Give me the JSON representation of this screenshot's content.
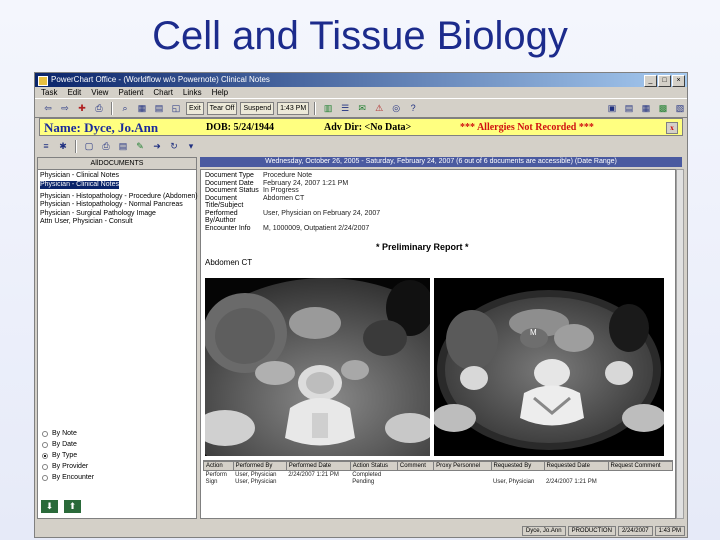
{
  "slide": {
    "title": "Cell and Tissue Biology"
  },
  "window": {
    "title": "PowerChart Office - (Worldflow w/o Powernote) Clinical Notes"
  },
  "menu": [
    "Task",
    "Edit",
    "View",
    "Patient",
    "Chart",
    "Links",
    "Help"
  ],
  "toolbar": {
    "exit_label": "Exit",
    "tearoff_label": "Tear Off",
    "suspend_label": "Suspend",
    "time_label": "1:43 PM"
  },
  "banner": {
    "name": "Name: Dyce, Jo.Ann",
    "dob": "DOB: 5/24/1944",
    "adv_dir": "Adv Dir: <No Data>",
    "allergies": "*** Allergies Not Recorded ***"
  },
  "left_panel": {
    "header": "AllDOCUMENTS",
    "items": [
      {
        "label": "Physician - Clinical Notes",
        "selected": false
      },
      {
        "label": "Physician - Clinical Notes",
        "selected": true
      },
      {
        "label": "Physician - Histopathology - Procedure (Abdomen)",
        "selected": false
      },
      {
        "label": "Physician - Histopathology - Normal Pancreas",
        "selected": false
      },
      {
        "label": "Physician - Surgical Pathology Image",
        "selected": false
      },
      {
        "label": "Attn User, Physician - Consult",
        "selected": false
      }
    ],
    "radios": [
      {
        "label": "By Note",
        "checked": false
      },
      {
        "label": "By Date",
        "checked": false
      },
      {
        "label": "By Type",
        "checked": true
      },
      {
        "label": "By Provider",
        "checked": false
      },
      {
        "label": "By Encounter",
        "checked": false
      }
    ]
  },
  "date_bar": "Wednesday, October 26, 2005 - Saturday, February 24, 2007 (6 out of 6 documents are accessible) (Date Range)",
  "document": {
    "fields": [
      {
        "k": "Document Type",
        "v": "Procedure Note"
      },
      {
        "k": "Document Date",
        "v": "February 24, 2007 1:21 PM"
      },
      {
        "k": "Document Status",
        "v": "In Progress"
      },
      {
        "k": "Document Title/Subject",
        "v": "Abdomen CT"
      },
      {
        "k": "Performed By/Author",
        "v": "User, Physician on February 24, 2007"
      },
      {
        "k": "Encounter Info",
        "v": "M, 1000009, Outpatient 2/24/2007"
      }
    ],
    "prelim": "* Preliminary Report *",
    "section": "Abdomen CT",
    "marker": "M"
  },
  "orders": {
    "headers": [
      "Action",
      "Performed By",
      "Performed Date",
      "Action Status",
      "Comment",
      "Proxy Personnel",
      "Requested By",
      "Requested Date",
      "Request Comment"
    ],
    "rows": [
      [
        "Perform",
        "User, Physician",
        "2/24/2007 1:21 PM",
        "Completed",
        "",
        "",
        "",
        "",
        ""
      ],
      [
        "Sign",
        "User, Physician",
        "",
        "Pending",
        "",
        "",
        "User, Physician",
        "2/24/2007 1:21 PM",
        ""
      ]
    ]
  },
  "status_bar": [
    "Dyce, Jo.Ann",
    "PRODUCTION",
    "2/24/2007",
    "1:43 PM"
  ]
}
